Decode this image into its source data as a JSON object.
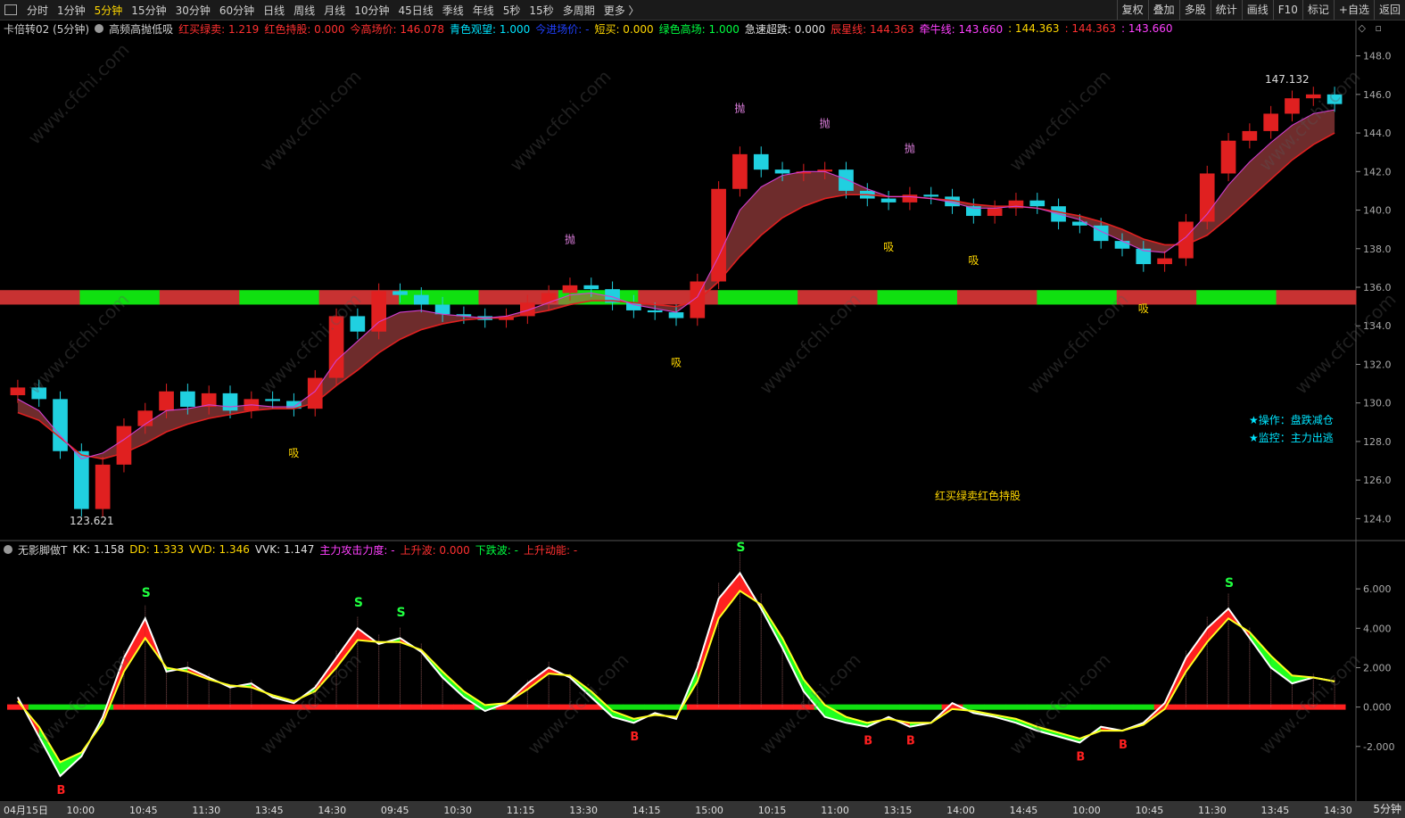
{
  "toolbar": {
    "periods": [
      "分时",
      "1分钟",
      "5分钟",
      "15分钟",
      "30分钟",
      "60分钟",
      "日线",
      "周线",
      "月线",
      "10分钟",
      "45日线",
      "季线",
      "年线",
      "5秒",
      "15秒",
      "多周期",
      "更多 〉"
    ],
    "active_period": "5分钟",
    "right_buttons": [
      "复权",
      "叠加",
      "多股",
      "统计",
      "画线",
      "F10",
      "标记",
      "+自选",
      "返回"
    ]
  },
  "main_header": {
    "symbol": "卡倍转02 (5分钟)",
    "formula": "高频高抛低吸",
    "items": [
      {
        "label": "红买绿卖: 1.219",
        "color": "#ff3030"
      },
      {
        "label": "红色持股: 0.000",
        "color": "#ff3030"
      },
      {
        "label": "今高场价: 146.078",
        "color": "#ff3030"
      },
      {
        "label": "青色观望: 1.000",
        "color": "#00e5ff"
      },
      {
        "label": "今进场价: -",
        "color": "#2040ff"
      },
      {
        "label": "短买: 0.000",
        "color": "#ffd700"
      },
      {
        "label": "绿色高场: 1.000",
        "color": "#00ff40"
      },
      {
        "label": "急速超跌: 0.000",
        "color": "#e0e0e0"
      },
      {
        "label": "辰星线: 144.363",
        "color": "#ff3030"
      },
      {
        "label": "牵牛线: 143.660",
        "color": "#ff40ff"
      },
      {
        "label": ": 144.363",
        "color": "#ffd700"
      },
      {
        "label": ": 144.363",
        "color": "#ff3030"
      },
      {
        "label": ": 143.660",
        "color": "#ff40ff"
      }
    ]
  },
  "indicator_header": {
    "name": "无影脚做T",
    "items": [
      {
        "label": "KK: 1.158",
        "color": "#e0e0e0"
      },
      {
        "label": "DD: 1.333",
        "color": "#ffd700"
      },
      {
        "label": "VVD: 1.346",
        "color": "#ffd700"
      },
      {
        "label": "VVK: 1.147",
        "color": "#e0e0e0"
      },
      {
        "label": "主力攻击力度: -",
        "color": "#ff40ff"
      },
      {
        "label": "上升波: 0.000",
        "color": "#ff3030"
      },
      {
        "label": "下跌波: -",
        "color": "#00ff40"
      },
      {
        "label": "上升动能: -",
        "color": "#ff3030"
      }
    ]
  },
  "annotations": {
    "low_label": "123.621",
    "high_label": "147.132",
    "operation": "★操作：盘跌减仓",
    "monitor": "★监控：主力出逃",
    "legend_text": "红买绿卖红色持股",
    "sell_mark": "抛",
    "buy_mark": "吸",
    "s_mark": "S",
    "b_mark": "B"
  },
  "period_label": "5分钟",
  "watermark": "www.cfchi.com",
  "chart_data": [
    {
      "type": "candlestick",
      "title": "卡倍转02 (5分钟)",
      "y_ticks": [
        124.0,
        126.0,
        128.0,
        130.0,
        132.0,
        134.0,
        136.0,
        138.0,
        140.0,
        142.0,
        144.0,
        146.0,
        148.0
      ],
      "ylim": [
        123.0,
        149.0
      ],
      "x_labels": [
        "04月15日",
        "10:00",
        "10:45",
        "11:30",
        "13:45",
        "14:30",
        "09:45",
        "10:30",
        "11:15",
        "13:30",
        "14:15",
        "15:00",
        "10:15",
        "11:00",
        "13:15",
        "14:00",
        "14:45",
        "10:00",
        "10:45",
        "11:30",
        "13:45",
        "14:30"
      ],
      "close": [
        130.8,
        130.2,
        127.5,
        124.5,
        126.8,
        128.8,
        129.6,
        130.6,
        129.8,
        130.5,
        129.6,
        130.2,
        130.1,
        129.7,
        131.3,
        134.5,
        133.7,
        135.8,
        135.6,
        135.1,
        134.6,
        134.5,
        134.3,
        134.5,
        135.2,
        135.7,
        136.1,
        135.9,
        135.2,
        134.8,
        134.7,
        134.4,
        136.3,
        141.1,
        142.9,
        142.1,
        141.9,
        142.0,
        142.1,
        141.0,
        140.6,
        140.4,
        140.8,
        140.7,
        140.2,
        139.7,
        140.1,
        140.5,
        140.2,
        139.4,
        139.2,
        138.4,
        138.0,
        137.2,
        137.5,
        139.4,
        141.9,
        143.6,
        144.1,
        145.0,
        145.8,
        146.0,
        145.5
      ],
      "ma_fast": [
        130.2,
        129.6,
        128.3,
        127.1,
        127.4,
        128.1,
        128.9,
        129.6,
        129.7,
        129.9,
        129.8,
        129.9,
        129.8,
        129.8,
        130.6,
        132.2,
        133.2,
        134.2,
        134.7,
        134.8,
        134.6,
        134.5,
        134.4,
        134.5,
        134.8,
        135.2,
        135.6,
        135.7,
        135.5,
        135.1,
        134.9,
        134.7,
        135.5,
        137.6,
        140.0,
        141.2,
        141.8,
        142.0,
        142.0,
        141.6,
        141.1,
        140.7,
        140.7,
        140.6,
        140.4,
        140.1,
        140.1,
        140.2,
        140.1,
        139.8,
        139.5,
        138.9,
        138.4,
        137.9,
        137.8,
        138.6,
        139.8,
        141.3,
        142.5,
        143.5,
        144.4,
        145.0,
        145.2
      ],
      "ma_slow": [
        129.5,
        129.1,
        128.2,
        127.3,
        127.1,
        127.4,
        127.9,
        128.5,
        128.9,
        129.2,
        129.4,
        129.6,
        129.7,
        129.7,
        130.0,
        130.9,
        131.7,
        132.6,
        133.3,
        133.8,
        134.1,
        134.3,
        134.4,
        134.4,
        134.6,
        134.8,
        135.1,
        135.3,
        135.3,
        135.2,
        135.1,
        135.0,
        135.3,
        136.3,
        137.6,
        138.7,
        139.6,
        140.2,
        140.6,
        140.8,
        140.8,
        140.7,
        140.7,
        140.6,
        140.5,
        140.3,
        140.2,
        140.2,
        140.1,
        139.9,
        139.7,
        139.4,
        139.0,
        138.5,
        138.2,
        138.2,
        138.7,
        139.6,
        140.6,
        141.6,
        142.6,
        143.4,
        144.0
      ],
      "state_bar": [
        "red",
        "green",
        "red",
        "green",
        "red",
        "green",
        "red",
        "green",
        "red",
        "green",
        "red",
        "green",
        "red",
        "green",
        "red",
        "green",
        "red"
      ]
    },
    {
      "type": "line",
      "title": "无影脚做T",
      "y_ticks": [
        -2.0,
        0.0,
        2.0,
        4.0,
        6.0
      ],
      "ylim": [
        -4.5,
        7.5
      ],
      "series": [
        {
          "name": "KK",
          "values": [
            0.5,
            -1.5,
            -3.5,
            -2.5,
            -0.5,
            2.5,
            4.5,
            1.8,
            2.0,
            1.5,
            1.0,
            1.2,
            0.5,
            0.2,
            1.0,
            2.5,
            4.0,
            3.2,
            3.5,
            2.8,
            1.5,
            0.5,
            -0.2,
            0.2,
            1.2,
            2.0,
            1.5,
            0.5,
            -0.5,
            -0.8,
            -0.3,
            -0.6,
            2.0,
            5.5,
            6.8,
            5.0,
            3.0,
            0.8,
            -0.5,
            -0.8,
            -1.0,
            -0.5,
            -1.0,
            -0.8,
            0.2,
            -0.3,
            -0.5,
            -0.8,
            -1.2,
            -1.5,
            -1.8,
            -1.0,
            -1.2,
            -0.8,
            0.2,
            2.5,
            4.0,
            5.0,
            3.5,
            2.0,
            1.2,
            1.5,
            1.3
          ]
        },
        {
          "name": "DD",
          "values": [
            0.3,
            -1.0,
            -2.8,
            -2.3,
            -0.8,
            1.8,
            3.5,
            2.0,
            1.8,
            1.4,
            1.1,
            1.0,
            0.6,
            0.3,
            0.8,
            2.0,
            3.4,
            3.3,
            3.3,
            2.9,
            1.8,
            0.8,
            0.1,
            0.2,
            0.9,
            1.7,
            1.6,
            0.8,
            -0.2,
            -0.6,
            -0.4,
            -0.5,
            1.3,
            4.5,
            5.9,
            5.2,
            3.5,
            1.4,
            0.1,
            -0.5,
            -0.8,
            -0.6,
            -0.8,
            -0.8,
            -0.1,
            -0.2,
            -0.4,
            -0.6,
            -1.0,
            -1.3,
            -1.6,
            -1.2,
            -1.2,
            -0.9,
            -0.1,
            1.8,
            3.3,
            4.5,
            3.8,
            2.6,
            1.6,
            1.5,
            1.3
          ]
        }
      ]
    }
  ]
}
